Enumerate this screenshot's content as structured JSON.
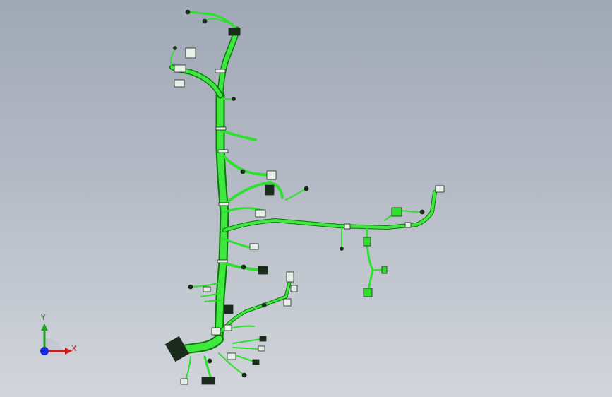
{
  "triad": {
    "x_label": "X",
    "y_label": "Y"
  },
  "colors": {
    "harness": "#2fe02f",
    "harness_dark": "#0b7a0b",
    "connector_light": "#e9f0e9",
    "connector_dark": "#1b2b1b",
    "background_top": "#a0a8b6",
    "background_bottom": "#d2d5db"
  }
}
